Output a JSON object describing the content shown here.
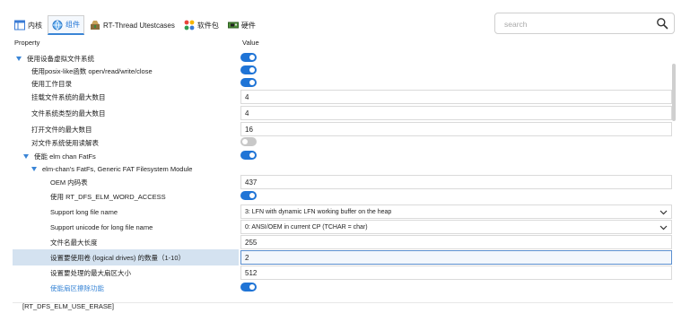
{
  "tabs": [
    {
      "label": "内核",
      "icon": "kernel-window-icon",
      "active": false
    },
    {
      "label": "组件",
      "icon": "component-globe-icon",
      "active": true
    },
    {
      "label": "RT-Thread Utestcases",
      "icon": "testcase-icon",
      "active": false
    },
    {
      "label": "软件包",
      "icon": "package-grid-icon",
      "active": false
    },
    {
      "label": "硬件",
      "icon": "hardware-board-icon",
      "active": false
    }
  ],
  "search": {
    "placeholder": "search",
    "value": ""
  },
  "headers": {
    "property": "Property",
    "value": "Value"
  },
  "rows": [
    {
      "label": "使用设备虚拟文件系统",
      "type": "toggle",
      "on": true,
      "indent": 0,
      "expander": true
    },
    {
      "label": "使用posix-like函数 open/read/write/close",
      "type": "toggle",
      "on": true,
      "indent": 1
    },
    {
      "label": "使用工作目录",
      "type": "toggle",
      "on": true,
      "indent": 1
    },
    {
      "label": "挂载文件系统的最大数目",
      "type": "input",
      "value": "4",
      "indent": 1
    },
    {
      "label": "文件系统类型的最大数目",
      "type": "input",
      "value": "4",
      "indent": 1
    },
    {
      "label": "打开文件的最大数目",
      "type": "input",
      "value": "16",
      "indent": 1
    },
    {
      "label": "对文件系统使用读解表",
      "type": "toggle",
      "on": false,
      "indent": 1
    },
    {
      "label": "使能 elm chan FatFs",
      "type": "toggle",
      "on": true,
      "indent": 1,
      "expander": true
    },
    {
      "label": "elm-chan's FatFs, Generic FAT Filesystem Module",
      "type": "none",
      "indent": 2,
      "expander": true
    },
    {
      "label": "OEM 内码表",
      "type": "input",
      "value": "437",
      "indent": 3
    },
    {
      "label": "使用 RT_DFS_ELM_WORD_ACCESS",
      "type": "toggle",
      "on": true,
      "indent": 3
    },
    {
      "label": "Support long file name",
      "type": "select",
      "value": "3: LFN with dynamic LFN working buffer on the heap",
      "indent": 3
    },
    {
      "label": "Support unicode for long file name",
      "type": "select",
      "value": "0: ANSI/OEM in current CP (TCHAR = char)",
      "indent": 3
    },
    {
      "label": "文件名最大长度",
      "type": "input",
      "value": "255",
      "indent": 3
    },
    {
      "label": "设置要使用卷 (logical drives) 的数量（1-10）",
      "type": "input",
      "value": "2",
      "indent": 3,
      "selected": true
    },
    {
      "label": "设置要处理的最大扇区大小",
      "type": "input",
      "value": "512",
      "indent": 3
    },
    {
      "label": "使能扇区擦除功能",
      "type": "toggle",
      "on": true,
      "indent": 3,
      "link": true
    }
  ],
  "footer": {
    "text": "[RT_DFS_ELM_USE_ERASE]"
  },
  "colors": {
    "accent": "#1f74d6",
    "selected_row": "#d4e2f0",
    "link": "#3a86d6"
  }
}
